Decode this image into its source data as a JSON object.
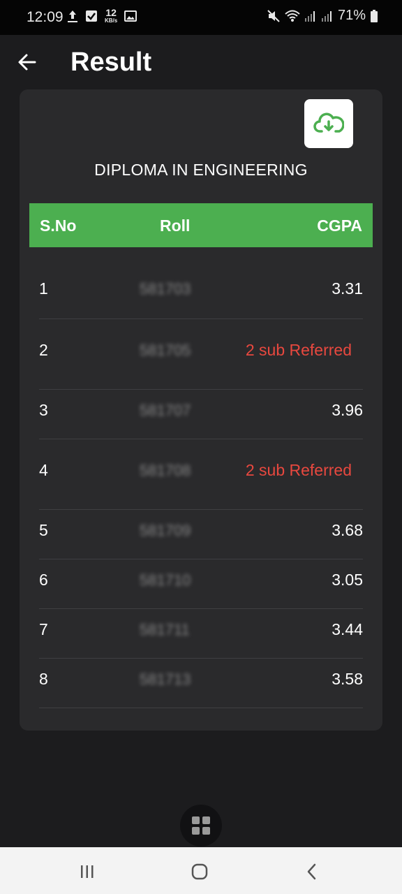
{
  "status_bar": {
    "time": "12:09",
    "speed_value": "12",
    "speed_unit": "KB/s",
    "battery": "71%"
  },
  "app_bar": {
    "title": "Result"
  },
  "card": {
    "course_title": "DIPLOMA IN ENGINEERING",
    "table": {
      "headers": {
        "sno": "S.No",
        "roll": "Roll",
        "cgpa": "CGPA"
      },
      "rows": [
        {
          "sno": "1",
          "roll": "581703",
          "cgpa": "3.31",
          "referred": false
        },
        {
          "sno": "2",
          "roll": "581705",
          "cgpa": "2 sub Referred",
          "referred": true
        },
        {
          "sno": "3",
          "roll": "581707",
          "cgpa": "3.96",
          "referred": false
        },
        {
          "sno": "4",
          "roll": "581708",
          "cgpa": "2 sub Referred",
          "referred": true
        },
        {
          "sno": "5",
          "roll": "581709",
          "cgpa": "3.68",
          "referred": false
        },
        {
          "sno": "6",
          "roll": "581710",
          "cgpa": "3.05",
          "referred": false
        },
        {
          "sno": "7",
          "roll": "581711",
          "cgpa": "3.44",
          "referred": false
        },
        {
          "sno": "8",
          "roll": "581713",
          "cgpa": "3.58",
          "referred": false
        }
      ]
    }
  },
  "colors": {
    "accent_green": "#4caf50",
    "referred_red": "#e8483f",
    "card_bg": "#2a2a2c",
    "page_bg": "#1c1c1e"
  },
  "icons": {
    "back": "arrow-left-icon",
    "download": "cloud-download-icon",
    "grid": "grid-icon",
    "nav_recent": "recent-apps-icon",
    "nav_home": "home-icon",
    "nav_back": "chevron-left-icon"
  }
}
